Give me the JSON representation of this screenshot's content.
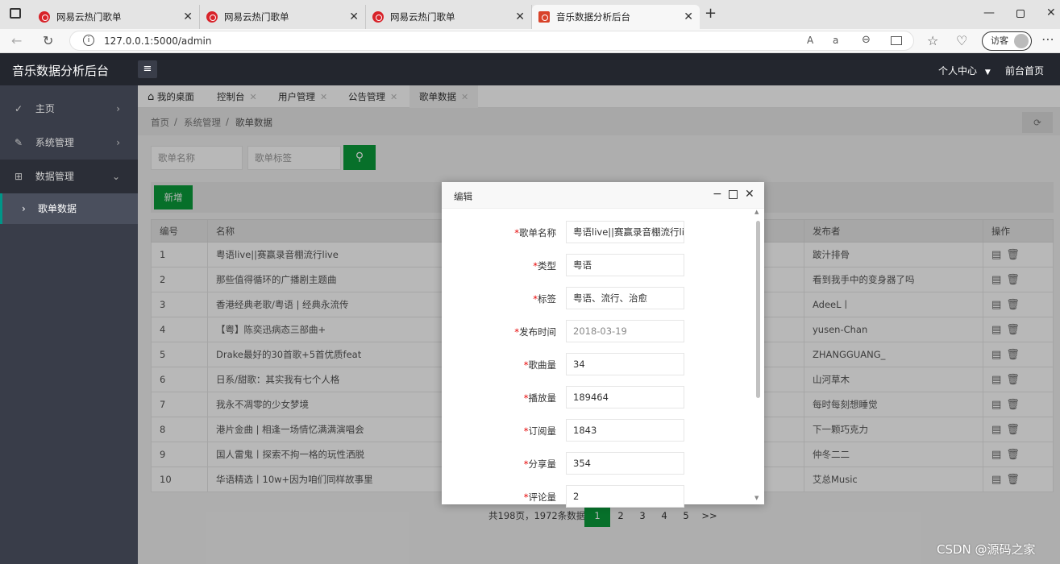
{
  "browser": {
    "tabs": [
      {
        "title": "网易云热门歌单"
      },
      {
        "title": "网易云热门歌单"
      },
      {
        "title": "网易云热门歌单"
      },
      {
        "title": "音乐数据分析后台"
      }
    ],
    "url": "127.0.0.1:5000/admin",
    "guest_label": "访客"
  },
  "app": {
    "title": "音乐数据分析后台",
    "header_links": {
      "profile": "个人中心",
      "frontpage": "前台首页"
    }
  },
  "sidebar": {
    "items": [
      {
        "label": "主页"
      },
      {
        "label": "系统管理"
      },
      {
        "label": "数据管理"
      }
    ],
    "sub_item": "歌单数据"
  },
  "content_tabs": [
    "我的桌面",
    "控制台",
    "用户管理",
    "公告管理",
    "歌单数据"
  ],
  "breadcrumb": [
    "首页",
    "系统管理",
    "歌单数据"
  ],
  "search": {
    "name_placeholder": "歌单名称",
    "tag_placeholder": "歌单标签"
  },
  "toolbar": {
    "add_label": "新增"
  },
  "table": {
    "headers": {
      "id": "编号",
      "name": "名称",
      "publisher": "发布者",
      "ops": "操作"
    },
    "rows": [
      {
        "id": "1",
        "name": "粤语live||赛赢录音棚流行live",
        "publisher": "跛汁排骨"
      },
      {
        "id": "2",
        "name": "那些值得循环的广播剧主题曲",
        "publisher": "看到我手中的变身器了吗"
      },
      {
        "id": "3",
        "name": "香港经典老歌/粤语 | 经典永流传",
        "publisher": "AdeeL丨"
      },
      {
        "id": "4",
        "name": "【粤】陈奕迅病态三部曲+",
        "publisher": "yusen-Chan"
      },
      {
        "id": "5",
        "name": "Drake最好的30首歌+5首优质feat",
        "publisher": "ZHANGGUANG_"
      },
      {
        "id": "6",
        "name": "日系/甜歌：其实我有七个人格",
        "publisher": "山河草木"
      },
      {
        "id": "7",
        "name": "我永不凋零的少女梦境",
        "publisher": "每时每刻想睡觉"
      },
      {
        "id": "8",
        "name": "港片金曲 | 相逢一场情忆满满演唱会",
        "publisher": "下一颗巧克力"
      },
      {
        "id": "9",
        "name": "国人雷鬼丨探索不拘一格的玩性洒脱",
        "publisher": "仲冬二二"
      },
      {
        "id": "10",
        "name": "华语精选丨10w+因为咱们同样故事里",
        "publisher": "艾总Music"
      }
    ]
  },
  "pagination": {
    "summary": "共198页，1972条数据",
    "pages": [
      "1",
      "2",
      "3",
      "4",
      "5",
      ">>"
    ],
    "current": "1"
  },
  "dialog": {
    "title": "编辑",
    "fields": [
      {
        "label": "歌单名称",
        "value": "粤语live||赛赢录音棚流行live"
      },
      {
        "label": "类型",
        "value": "粤语"
      },
      {
        "label": "标签",
        "value": "粤语、流行、治愈"
      },
      {
        "label": "发布时间",
        "value": "2018-03-19"
      },
      {
        "label": "歌曲量",
        "value": "34"
      },
      {
        "label": "播放量",
        "value": "189464"
      },
      {
        "label": "订阅量",
        "value": "1843"
      },
      {
        "label": "分享量",
        "value": "354"
      },
      {
        "label": "评论量",
        "value": "2"
      }
    ]
  },
  "watermark": "CSDN @源码之家",
  "colors": {
    "accent_green": "#0a9b3b",
    "sidebar_bg": "#393d49",
    "header_bg": "#23262e"
  }
}
